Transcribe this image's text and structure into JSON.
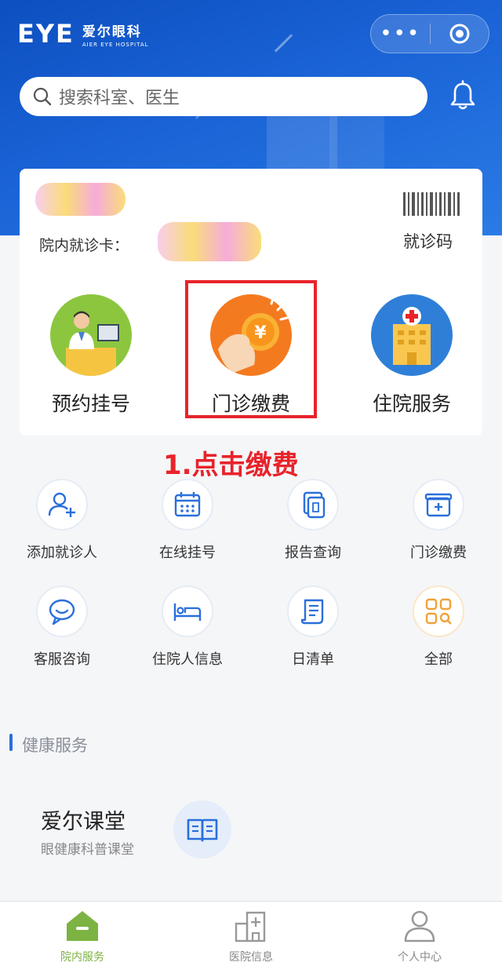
{
  "header": {
    "logo_mark": "EYE",
    "logo_cn": "爱尔眼科",
    "logo_en": "AIER EYE HOSPITAL",
    "capsule_more": "•••",
    "search_placeholder": "搜索科室、医生"
  },
  "card": {
    "card_label": "院内就诊卡：",
    "code_label": "就诊码"
  },
  "big_services": [
    {
      "label": "预约挂号",
      "icon": "doctor-desk-icon"
    },
    {
      "label": "门诊缴费",
      "icon": "hand-coin-icon"
    },
    {
      "label": "住院服务",
      "icon": "hospital-building-icon"
    }
  ],
  "annotation": "1.点击缴费",
  "grid": [
    {
      "label": "添加就诊人",
      "icon": "add-user-icon"
    },
    {
      "label": "在线挂号",
      "icon": "calendar-icon"
    },
    {
      "label": "报告查询",
      "icon": "report-icon"
    },
    {
      "label": "门诊缴费",
      "icon": "payment-box-icon"
    },
    {
      "label": "客服咨询",
      "icon": "chat-icon"
    },
    {
      "label": "住院人信息",
      "icon": "bed-icon"
    },
    {
      "label": "日清单",
      "icon": "list-icon"
    },
    {
      "label": "全部",
      "icon": "all-apps-icon"
    }
  ],
  "health": {
    "section_title": "健康服务",
    "course_title": "爱尔课堂",
    "course_subtitle": "眼健康科普课堂"
  },
  "tabbar": [
    {
      "label": "院内服务",
      "icon": "home-icon",
      "active": true
    },
    {
      "label": "医院信息",
      "icon": "hospital-info-icon",
      "active": false
    },
    {
      "label": "个人中心",
      "icon": "person-icon",
      "active": false
    }
  ],
  "colors": {
    "brand_blue": "#1a63d6",
    "highlight_red": "#e8232a",
    "tab_active_green": "#7cb342"
  }
}
